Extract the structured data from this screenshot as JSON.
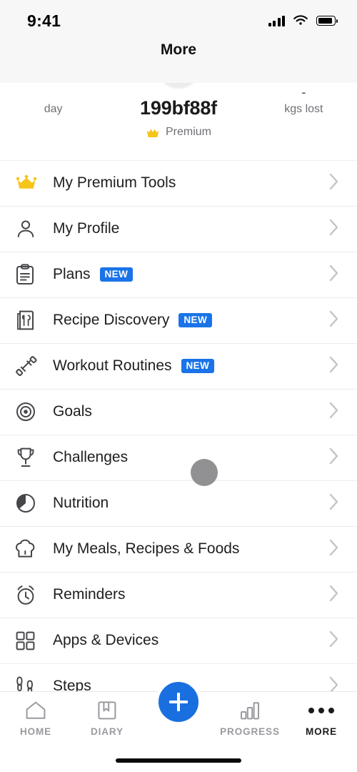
{
  "status_bar": {
    "time": "9:41",
    "signal_icon": "cellular-signal-icon",
    "wifi_icon": "wifi-icon",
    "battery_icon": "battery-icon"
  },
  "header": {
    "title": "More"
  },
  "profile": {
    "stat_left": {
      "value": "",
      "label": "day"
    },
    "username": "199bf88f",
    "premium_label": "Premium",
    "premium_icon": "crown-icon",
    "stat_right": {
      "value": "-",
      "label": "kgs lost"
    }
  },
  "menu": {
    "items": [
      {
        "label": "My Premium Tools",
        "icon": "crown-icon",
        "badge": ""
      },
      {
        "label": "My Profile",
        "icon": "person-icon",
        "badge": ""
      },
      {
        "label": "Plans",
        "icon": "clipboard-icon",
        "badge": "NEW"
      },
      {
        "label": "Recipe Discovery",
        "icon": "recipe-card-icon",
        "badge": "NEW"
      },
      {
        "label": "Workout Routines",
        "icon": "dumbbell-icon",
        "badge": "NEW"
      },
      {
        "label": "Goals",
        "icon": "target-icon",
        "badge": ""
      },
      {
        "label": "Challenges",
        "icon": "trophy-icon",
        "badge": ""
      },
      {
        "label": "Nutrition",
        "icon": "pie-chart-icon",
        "badge": ""
      },
      {
        "label": "My Meals, Recipes & Foods",
        "icon": "chef-hat-icon",
        "badge": ""
      },
      {
        "label": "Reminders",
        "icon": "alarm-clock-icon",
        "badge": ""
      },
      {
        "label": "Apps & Devices",
        "icon": "grid-squares-icon",
        "badge": ""
      },
      {
        "label": "Steps",
        "icon": "footprints-icon",
        "badge": ""
      }
    ],
    "chevron_icon": "chevron-right-icon"
  },
  "tabbar": {
    "tabs": [
      {
        "label": "HOME",
        "icon": "home-icon",
        "active": false
      },
      {
        "label": "DIARY",
        "icon": "book-icon",
        "active": false
      },
      {
        "label": "PROGRESS",
        "icon": "bar-chart-icon",
        "active": false
      },
      {
        "label": "MORE",
        "icon": "ellipsis-icon",
        "active": true
      }
    ],
    "fab_icon": "plus-icon"
  },
  "colors": {
    "accent_blue": "#1a73e8",
    "fab_blue": "#1a6fe0",
    "premium_gold": "#f5c518",
    "icon_gray": "#46464a",
    "chevron_gray": "#c3c3c8"
  },
  "touch_indicator": {
    "name": "touch-point"
  }
}
